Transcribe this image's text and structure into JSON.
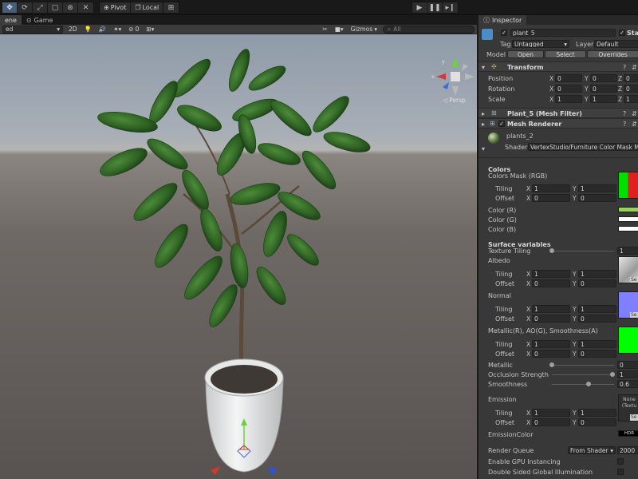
{
  "toolbar": {
    "pivot_label": "Pivot",
    "local_label": "Local"
  },
  "scene_tabs": {
    "scene_label": "ene",
    "game_label": "Game"
  },
  "scene_bar": {
    "shading_mode": "ed",
    "two_d_label": "2D",
    "fx_count": "0",
    "gizmos_label": "Gizmos",
    "search_placeholder": "All",
    "persp_label": "Persp"
  },
  "inspector": {
    "tab_label": "Inspector",
    "object_name": "plant_5",
    "static_label": "Stati",
    "tag_label": "Tag",
    "tag_value": "Untagged",
    "layer_label": "Layer",
    "layer_value": "Default",
    "model_label": "Model",
    "open_label": "Open",
    "select_label": "Select",
    "overrides_label": "Overrides",
    "transform": {
      "title": "Transform",
      "position_label": "Position",
      "rotation_label": "Rotation",
      "scale_label": "Scale",
      "position": {
        "x": "0",
        "y": "0",
        "z": "0"
      },
      "rotation": {
        "x": "0",
        "y": "0",
        "z": "0"
      },
      "scale": {
        "x": "1",
        "y": "1",
        "z": "1"
      }
    },
    "mesh_filter_title": "Plant_5 (Mesh Filter)",
    "mesh_renderer_title": "Mesh Renderer",
    "material": {
      "name": "plants_2",
      "shader_label": "Shader",
      "shader_value": "VertexStudio/Furniture Color Mask Meta"
    },
    "colors_section": "Colors",
    "colors_mask_label": "Colors Mask (RGB)",
    "tiling_label": "Tiling",
    "offset_label": "Offset",
    "mask_tiling": {
      "x": "1",
      "y": "1"
    },
    "mask_offset": {
      "x": "0",
      "y": "0"
    },
    "color_r_label": "Color (R)",
    "color_g_label": "Color (G)",
    "color_b_label": "Color (B)",
    "surface_section": "Surface variables",
    "texture_tiling_label": "Texture Tiling",
    "texture_tiling_value": "1",
    "albedo_label": "Albedo",
    "albedo_tiling": {
      "x": "1",
      "y": "1"
    },
    "albedo_offset": {
      "x": "0",
      "y": "0"
    },
    "normal_label": "Normal",
    "normal_tiling": {
      "x": "1",
      "y": "1"
    },
    "normal_offset": {
      "x": "0",
      "y": "0"
    },
    "metallic_map_label": "Metallic(R), AO(G), Smoothness(A)",
    "metallic_tiling": {
      "x": "1",
      "y": "1"
    },
    "metallic_offset": {
      "x": "0",
      "y": "0"
    },
    "metallic_label": "Metallic",
    "metallic_value": "0",
    "occlusion_label": "Occlusion Strength",
    "occlusion_value": "1",
    "smoothness_label": "Smoothness",
    "smoothness_value": "0.6",
    "emission_label": "Emission",
    "emission_none_label": "None",
    "emission_texture_label": "(Textu",
    "emission_tiling": {
      "x": "1",
      "y": "1"
    },
    "emission_offset": {
      "x": "0",
      "y": "0"
    },
    "emission_color_label": "EmissionColor",
    "hdr_label": "HDR",
    "render_queue_label": "Render Queue",
    "render_queue_mode": "From Shader",
    "render_queue_value": "2000",
    "gpu_instancing_label": "Enable GPU Instancing",
    "double_sided_label": "Double Sided Global Illumination",
    "select_small_label": "Se",
    "x_label": "X",
    "y_label": "Y",
    "z_label": "Z"
  },
  "colors": {
    "color_r": "#9ad35a",
    "color_g": "#ffffff",
    "color_b": "#ffffff",
    "mask_green": "#00e000",
    "normal_blue": "#8080ff",
    "metallic_green": "#00ff00"
  }
}
